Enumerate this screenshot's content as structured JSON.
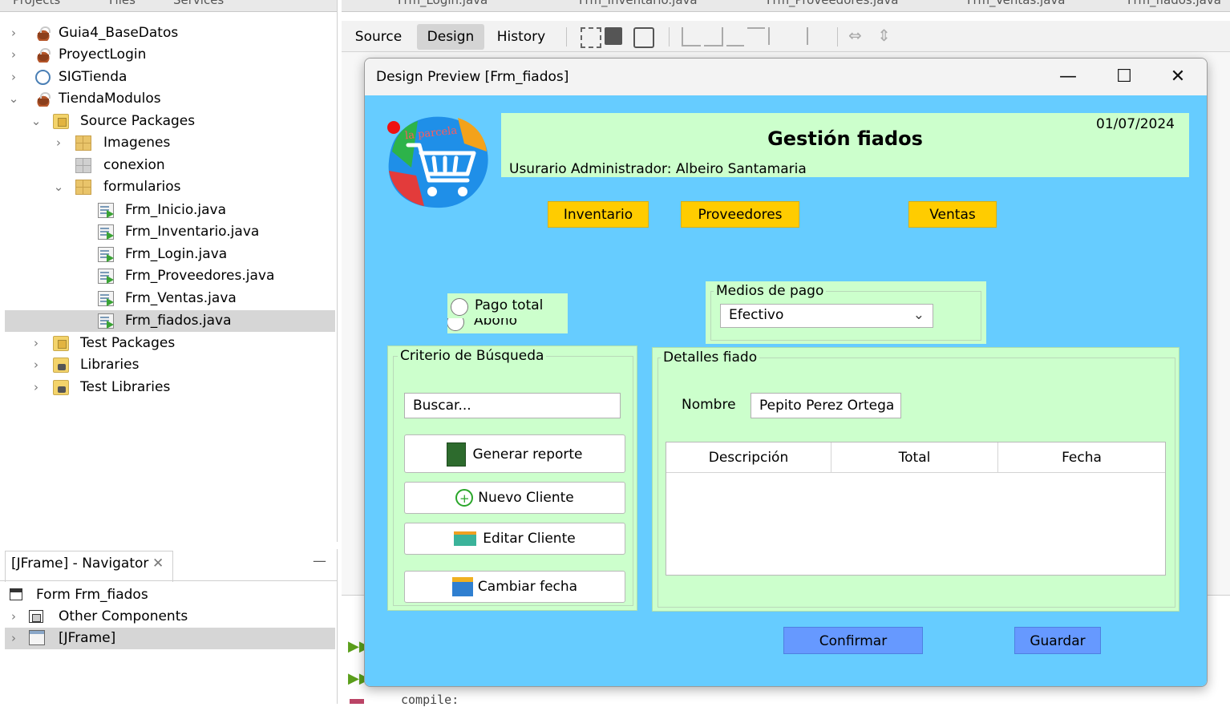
{
  "ide": {
    "left_tabs": [
      "Projects",
      "Files",
      "Services"
    ],
    "project_tree": [
      {
        "label": "Guia4_BaseDatos",
        "icon": "java-project-icon"
      },
      {
        "label": "ProyectLogin",
        "icon": "java-project-icon"
      },
      {
        "label": "SIGTienda",
        "icon": "web-project-icon"
      },
      {
        "label": "TiendaModulos",
        "icon": "java-project-icon"
      },
      {
        "label": "Source Packages",
        "icon": "source-folder-icon"
      },
      {
        "label": "Imagenes",
        "icon": "package-icon"
      },
      {
        "label": "conexion",
        "icon": "empty-package-icon"
      },
      {
        "label": "formularios",
        "icon": "package-icon"
      },
      {
        "label": "Frm_Inicio.java",
        "icon": "java-form-icon"
      },
      {
        "label": "Frm_Inventario.java",
        "icon": "java-form-icon"
      },
      {
        "label": "Frm_Login.java",
        "icon": "java-form-icon"
      },
      {
        "label": "Frm_Proveedores.java",
        "icon": "java-form-icon"
      },
      {
        "label": "Frm_Ventas.java",
        "icon": "java-form-icon"
      },
      {
        "label": "Frm_fiados.java",
        "icon": "java-form-icon"
      },
      {
        "label": "Test Packages",
        "icon": "test-folder-icon"
      },
      {
        "label": "Libraries",
        "icon": "library-icon"
      },
      {
        "label": "Test Libraries",
        "icon": "library-icon"
      }
    ],
    "navigator": {
      "tab_label": "[JFrame] - Navigator",
      "items": [
        {
          "label": "Form Frm_fiados",
          "icon": "form-icon"
        },
        {
          "label": "Other Components",
          "icon": "components-icon"
        },
        {
          "label": "[JFrame]",
          "icon": "jframe-icon"
        }
      ]
    },
    "editor_tabs": [
      "Frm_Login.java",
      "Frm_Inventario.java",
      "Frm_Proveedores.java",
      "Frm_Ventas.java",
      "Frm_fiados.java"
    ],
    "toolbar": {
      "source": "Source",
      "design": "Design",
      "history": "History"
    },
    "output": {
      "line1": "compile:"
    }
  },
  "preview": {
    "window_title": "Design Preview [Frm_fiados]",
    "date": "01/07/2024",
    "title": "Gestión fiados",
    "user": "Usurario Administrador: Albeiro Santamaria",
    "logo_text": "la parcela",
    "nav_buttons": {
      "inventario": "Inventario",
      "proveedores": "Proveedores",
      "ventas": "Ventas"
    },
    "radios": {
      "total": "Pago total",
      "abono": "Abono"
    },
    "payment": {
      "group_title": "Medios de pago",
      "selected": "Efectivo"
    },
    "search": {
      "group_title": "Criterio de Búsqueda",
      "placeholder": "Buscar...",
      "buttons": {
        "report": "Generar  reporte",
        "new_client": "Nuevo Cliente",
        "edit_client": "Editar Cliente",
        "change_date": "Cambiar fecha"
      }
    },
    "details": {
      "group_title": "Detalles fiado",
      "name_label": "Nombre",
      "name_value": "Pepito Perez Ortega",
      "columns": [
        "Descripción",
        "Total",
        "Fecha"
      ]
    },
    "confirm": "Confirmar",
    "save": "Guardar",
    "colors": {
      "background": "#66ccff",
      "panel": "#ccffcc",
      "nav_button": "#ffcc00",
      "action_button": "#6699ff"
    }
  }
}
